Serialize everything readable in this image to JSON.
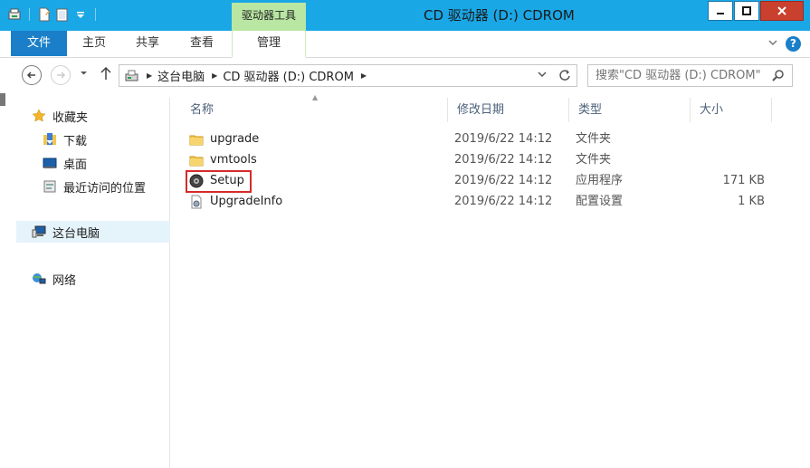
{
  "window": {
    "title": "CD 驱动器 (D:) CDROM",
    "contextual_tab_header": "驱动器工具"
  },
  "ribbon": {
    "tabs": [
      "文件",
      "主页",
      "共享",
      "查看",
      "管理"
    ],
    "active_tab": "管理"
  },
  "navigation": {
    "breadcrumb": [
      "这台电脑",
      "CD 驱动器 (D:) CDROM"
    ],
    "search_placeholder": "搜索\"CD 驱动器 (D:) CDROM\""
  },
  "sidebar": {
    "favorites_label": "收藏夹",
    "favorites": [
      "下载",
      "桌面",
      "最近访问的位置"
    ],
    "this_pc_label": "这台电脑",
    "network_label": "网络"
  },
  "columns": [
    "名称",
    "修改日期",
    "类型",
    "大小"
  ],
  "files": [
    {
      "name": "upgrade",
      "date": "2019/6/22 14:12",
      "type": "文件夹",
      "size": "",
      "icon": "folder-icon"
    },
    {
      "name": "vmtools",
      "date": "2019/6/22 14:12",
      "type": "文件夹",
      "size": "",
      "icon": "folder-icon"
    },
    {
      "name": "Setup",
      "date": "2019/6/22 14:12",
      "type": "应用程序",
      "size": "171 KB",
      "icon": "setup-app-icon"
    },
    {
      "name": "UpgradeInfo",
      "date": "2019/6/22 14:12",
      "type": "配置设置",
      "size": "1 KB",
      "icon": "config-file-icon"
    }
  ],
  "colors": {
    "titlebar": "#1aa7e6",
    "file_tab": "#1a7fc8",
    "contextual_tab": "#b9e6a3",
    "highlight": "#d62b2b"
  }
}
